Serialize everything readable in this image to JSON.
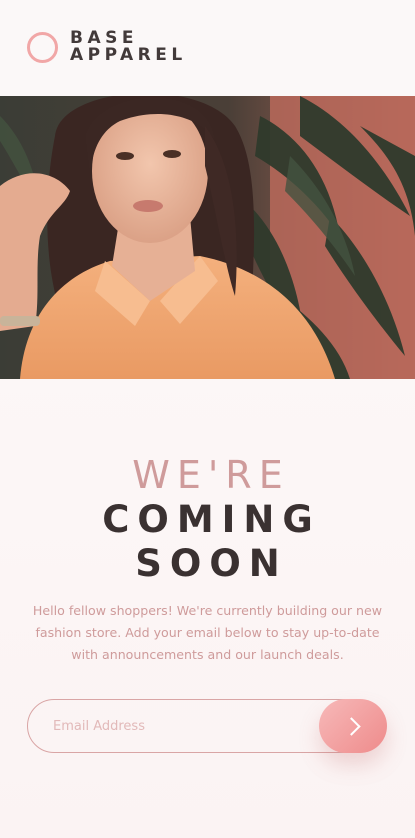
{
  "brand": {
    "line1": "BASE",
    "line2": "APPAREL"
  },
  "hero": {
    "image_description": "photo-of-woman-in-orange-shirt"
  },
  "headline": {
    "light": "WE'RE",
    "bold_line1": "COMING",
    "bold_line2": "SOON"
  },
  "description": "Hello fellow shoppers! We're currently building our new fashion store. Add your email below to stay up-to-date with announcements and our launch deals.",
  "form": {
    "email_placeholder": "Email Address",
    "email_value": "",
    "submit_icon": "chevron-right-icon"
  },
  "colors": {
    "accent": "#f1a7a7",
    "text_dark": "#3a3131",
    "text_pink": "#cf9b9b",
    "background": "#fbf6f6"
  }
}
